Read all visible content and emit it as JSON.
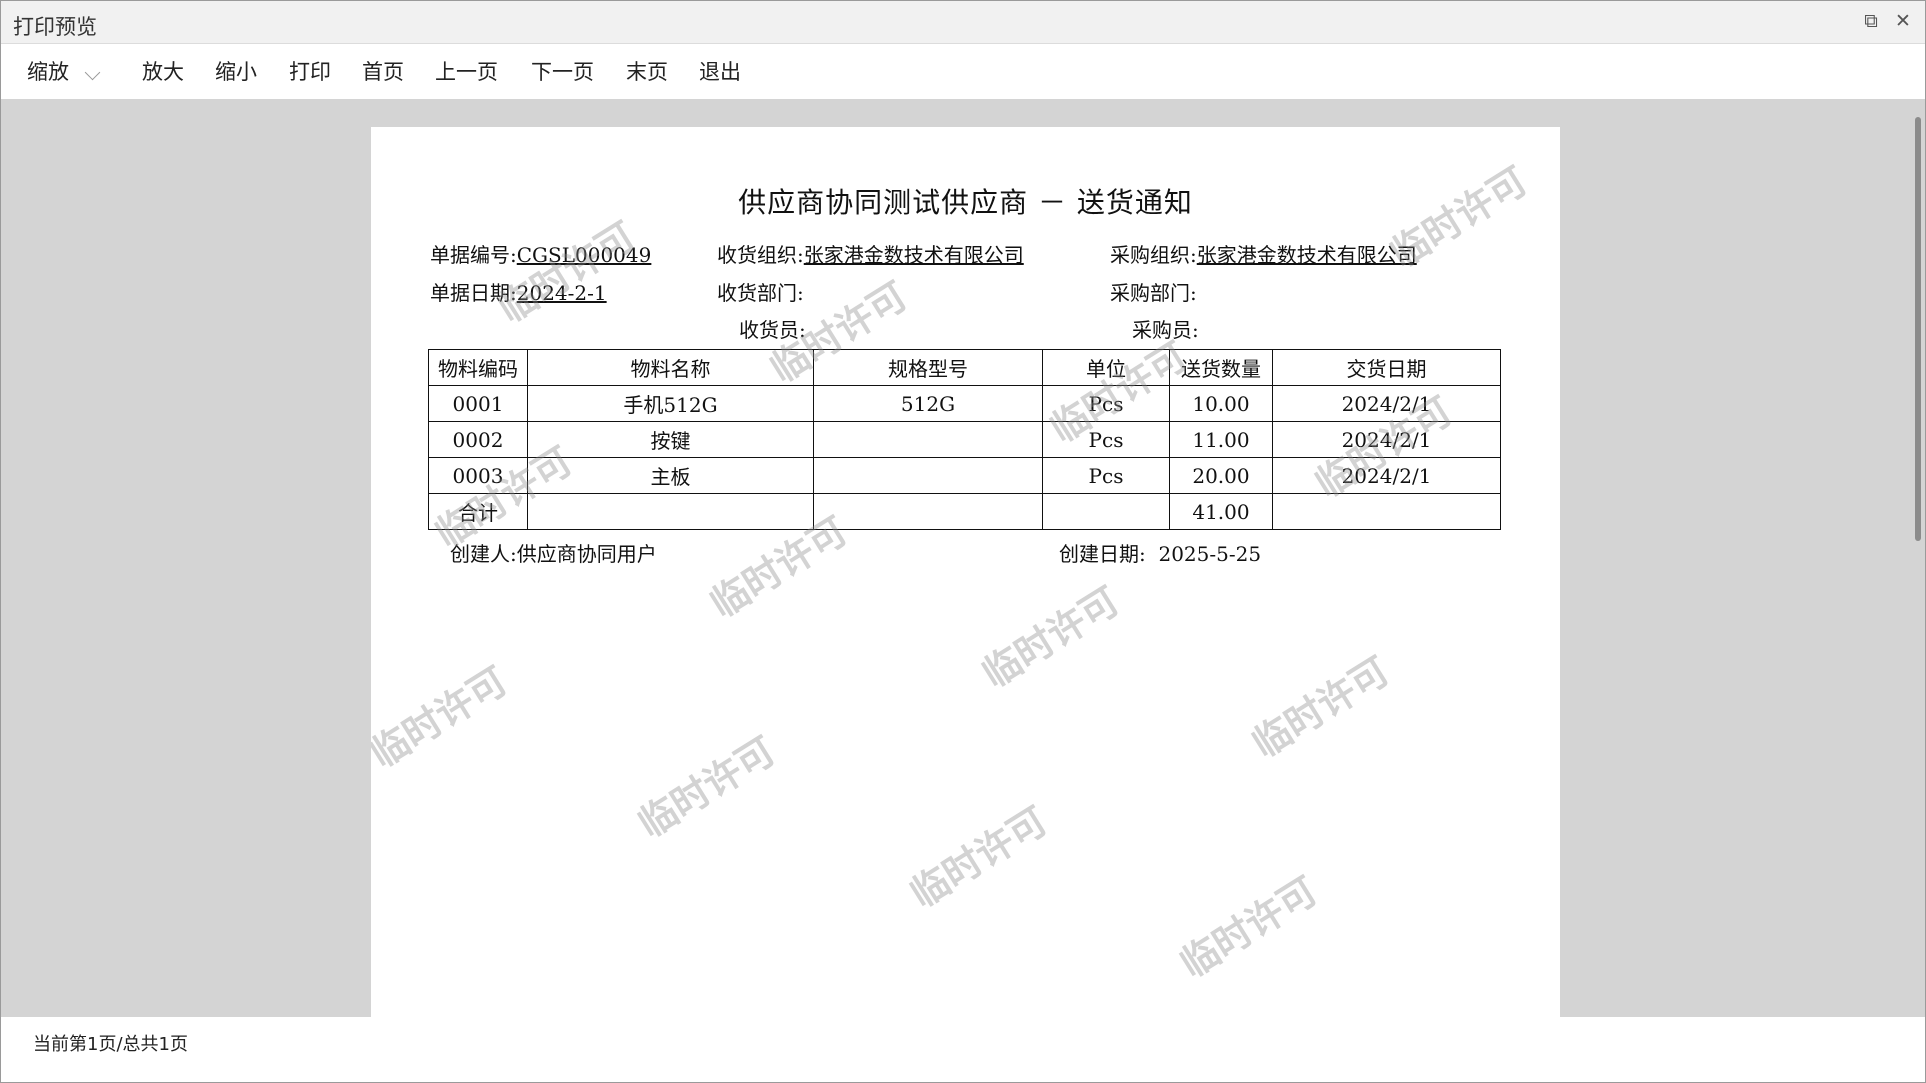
{
  "window": {
    "title": "打印预览",
    "restore_glyph": "⧉",
    "close_glyph": "✕"
  },
  "toolbar": {
    "zoom": "缩放",
    "zoom_in": "放大",
    "zoom_out": "缩小",
    "print": "打印",
    "first_page": "首页",
    "prev_page": "上一页",
    "next_page": "下一页",
    "last_page": "末页",
    "exit": "退出"
  },
  "document": {
    "title": "供应商协同测试供应商 － 送货通知",
    "bill_no_label": "单据编号:",
    "bill_no": "CGSL000049",
    "bill_date_label": "单据日期:",
    "bill_date": "2024-2-1",
    "recv_org_label": "收货组织:",
    "recv_org": "张家港金数技术有限公司",
    "recv_dept_label": "收货部门:",
    "receiver_label": "收货员:",
    "purch_org_label": "采购组织:",
    "purch_org": "张家港金数技术有限公司",
    "purch_dept_label": "采购部门:",
    "buyer_label": "采购员:",
    "table": {
      "headers": [
        "物料编码",
        "物料名称",
        "规格型号",
        "单位",
        "送货数量",
        "交货日期"
      ],
      "rows": [
        [
          "0001",
          "手机512G",
          "512G",
          "Pcs",
          "10.00",
          "2024/2/1"
        ],
        [
          "0002",
          "按键",
          "",
          "Pcs",
          "11.00",
          "2024/2/1"
        ],
        [
          "0003",
          "主板",
          "",
          "Pcs",
          "20.00",
          "2024/2/1"
        ]
      ],
      "total_label": "合计",
      "total_qty": "41.00"
    },
    "creator_label": "创建人:",
    "creator": "供应商协同用户",
    "created_label": "创建日期:",
    "created_date": "2025-5-25",
    "watermark": "临时许可"
  },
  "status": {
    "page_info": "当前第1页/总共1页"
  }
}
